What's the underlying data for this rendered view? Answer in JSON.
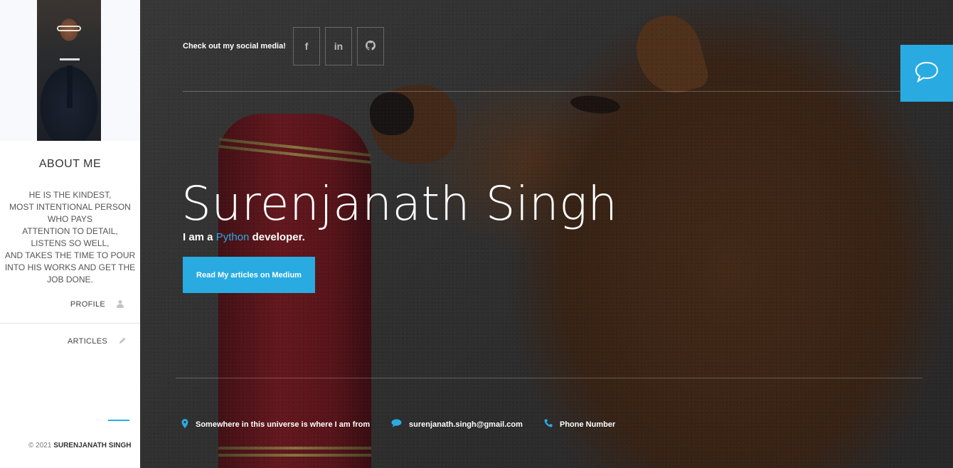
{
  "sidebar": {
    "about_title": "ABOUT ME",
    "about_lines": [
      "HE IS THE KINDEST,",
      "MOST INTENTIONAL PERSON",
      "WHO PAYS",
      "ATTENTION TO DETAIL,",
      "LISTENS SO WELL,",
      "AND TAKES THE TIME TO POUR",
      "INTO HIS WORKS AND GET THE",
      "JOB DONE."
    ],
    "nav": [
      {
        "label": "PROFILE",
        "icon": "user-icon",
        "active": true
      },
      {
        "label": "ARTICLES",
        "icon": "pencil-icon",
        "active": false
      }
    ],
    "copyright_prefix": "© 2021",
    "copyright_name": "SURENJANATH SINGH"
  },
  "hero": {
    "social_label": "Check out my social media!",
    "social": [
      {
        "icon": "facebook-icon",
        "glyph": "f"
      },
      {
        "icon": "linkedin-icon",
        "glyph": "in"
      },
      {
        "icon": "github-icon",
        "glyph": "◉"
      }
    ],
    "name": "Surenjanath Singh",
    "tagline_prefix": "I am a ",
    "tagline_highlight": "Python",
    "tagline_suffix": " developer.",
    "cta_label": "Read My articles on Medium",
    "contacts": {
      "location": "Somewhere in this universe is where I am from",
      "email": "surenjanath.singh@gmail.com",
      "phone": "Phone Number"
    }
  },
  "colors": {
    "accent": "#29abe2"
  }
}
